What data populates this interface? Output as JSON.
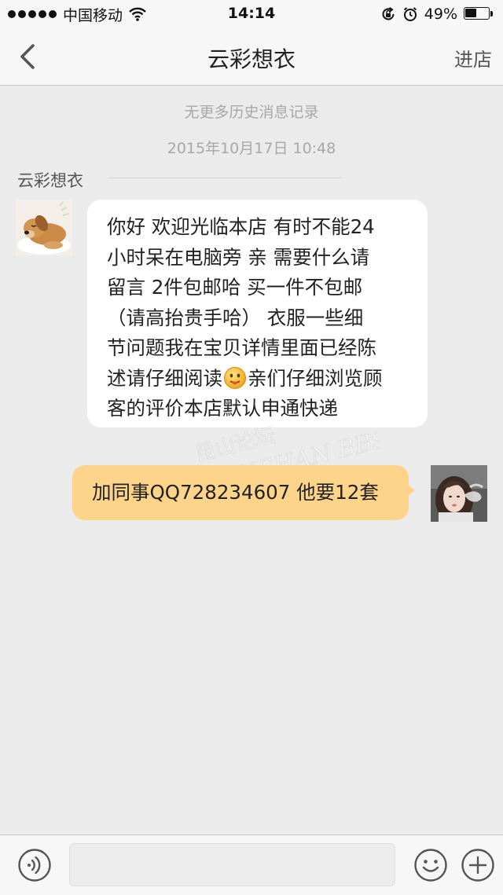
{
  "status_bar": {
    "carrier": "中国移动",
    "time": "14:14",
    "battery_percent": "49%",
    "battery_level": 0.49,
    "icons": [
      "signal-dots-icon",
      "wifi-icon",
      "rotation-lock-icon",
      "alarm-icon",
      "battery-icon"
    ]
  },
  "nav": {
    "back_icon": "chevron-left-icon",
    "title": "云彩想衣",
    "enter_store": "进店"
  },
  "chat": {
    "history_note": "无更多历史消息记录",
    "timestamp": "2015年10月17日 10:48",
    "sender_name": "云彩想衣",
    "incoming": {
      "avatar": "puppy-avatar",
      "lines": [
        "你好 欢迎光临本店 有时不能24",
        "小时呆在电脑旁 亲 需要什么请",
        "留言 2件包邮哈 买一件不包邮",
        "（请高抬贵手哈）  衣服一些细",
        "节问题我在宝贝详情里面已经陈"
      ],
      "line6_before": "述请仔细阅读",
      "line6_emoji": "smiley-emoji-icon",
      "line6_after": "亲们仔细浏览顾",
      "line7": "客的评价本店默认申通快递"
    },
    "outgoing": {
      "avatar": "girl-photo-avatar",
      "text": "加同事QQ728234607 他要12套"
    },
    "watermark": {
      "line1": "昆山论坛",
      "line2": "KUNSHAN BBS"
    }
  },
  "input_bar": {
    "voice_icon": "voice-icon",
    "input_value": "",
    "emoji_icon": "emoji-icon",
    "plus_icon": "plus-icon"
  },
  "colors": {
    "background": "#ebebeb",
    "bar": "#f7f7f7",
    "incoming_bubble": "#ffffff",
    "outgoing_bubble": "#fdd48a",
    "muted_text": "#a8a8a8"
  }
}
